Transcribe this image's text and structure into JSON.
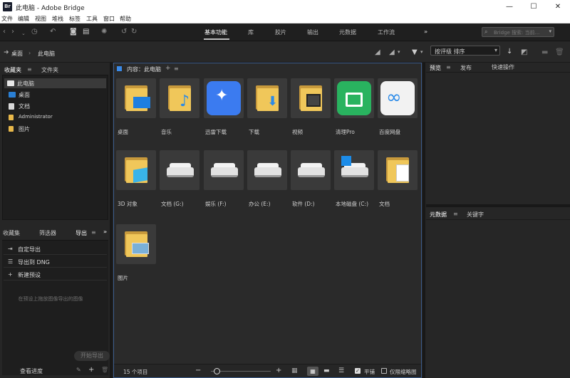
{
  "window": {
    "app_icon": "Br",
    "title": "此电脑 - Adobe Bridge",
    "minimize": "—",
    "maximize": "☐",
    "close": "✕"
  },
  "menu": [
    "文件",
    "编辑",
    "视图",
    "堆栈",
    "标签",
    "工具",
    "窗口",
    "帮助"
  ],
  "toolbar": {
    "workspaces": [
      "基本功能",
      "库",
      "胶片",
      "输出",
      "元数据",
      "工作流"
    ],
    "active_workspace": "基本功能",
    "more": "»",
    "search_placeholder": "Bridge 搜索: 当前..."
  },
  "path": {
    "crumbs": [
      "桌面",
      "此电脑"
    ],
    "sort_label": "按评级 排序"
  },
  "left_top": {
    "tabs": [
      "收藏夹",
      "文件夹"
    ],
    "items": [
      {
        "label": "此电脑",
        "color": "#e8e8e8",
        "selected": true
      },
      {
        "label": "桌面",
        "color": "#2a7fd4"
      },
      {
        "label": "文档",
        "color": "#d9d9d9"
      },
      {
        "label": "Administrator",
        "color": "#e8b84a"
      },
      {
        "label": "图片",
        "color": "#e8b84a"
      }
    ]
  },
  "left_bottom": {
    "tabs": [
      "收藏集",
      "筛选器",
      "导出"
    ],
    "more": "»",
    "items": [
      {
        "icon": "⇥",
        "label": "自定导出"
      },
      {
        "icon": "☰",
        "label": "导出到 DNG"
      },
      {
        "icon": "+",
        "label": "新建预设"
      }
    ],
    "hint": "在预设上拖放图像导出的图像",
    "start_button": "开始导出",
    "queue": "查看进度"
  },
  "content": {
    "header": "内容：此电脑",
    "items": [
      {
        "label": "桌面",
        "type": "folder"
      },
      {
        "label": "音乐",
        "type": "folder"
      },
      {
        "label": "迅雷下载",
        "type": "app",
        "bg": "#3b7bf0"
      },
      {
        "label": "下载",
        "type": "folder"
      },
      {
        "label": "视频",
        "type": "folder"
      },
      {
        "label": "清理Pro",
        "type": "app",
        "bg": "#29b35f"
      },
      {
        "label": "百度网盘",
        "type": "app",
        "bg": "#f2f2f2"
      },
      {
        "label": "3D 对象",
        "type": "folder"
      },
      {
        "label": "文档 (G:)",
        "type": "drive"
      },
      {
        "label": "娱乐 (F:)",
        "type": "drive"
      },
      {
        "label": "办公 (E:)",
        "type": "drive"
      },
      {
        "label": "软件 (D:)",
        "type": "drive"
      },
      {
        "label": "本地磁盘 (C:)",
        "type": "drive"
      },
      {
        "label": "文档",
        "type": "folder"
      },
      {
        "label": "图片",
        "type": "folder"
      }
    ],
    "count": "15 个项目",
    "tile": "平铺",
    "thumb_only": "仅限缩略图",
    "zoom_percent": 10
  },
  "right_top": {
    "tabs": [
      "预览",
      "发布",
      "快速操作"
    ]
  },
  "right_bottom": {
    "tabs": [
      "元数据",
      "关键字"
    ]
  }
}
